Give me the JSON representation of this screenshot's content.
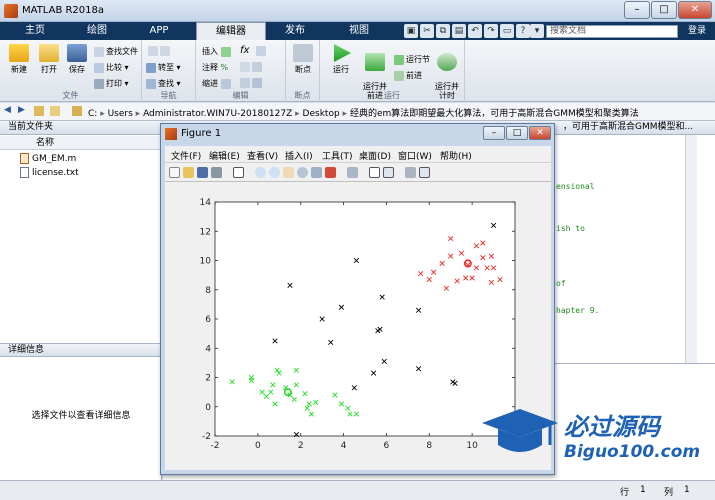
{
  "window": {
    "title": "MATLAB R2018a",
    "controls": {
      "minimize": "–",
      "maximize": "□",
      "close": "✕"
    }
  },
  "tabs": [
    {
      "label": "主页",
      "active": false
    },
    {
      "label": "绘图",
      "active": false
    },
    {
      "label": "APP",
      "active": false
    },
    {
      "label": "编辑器",
      "active": true
    },
    {
      "label": "发布",
      "active": false
    },
    {
      "label": "视图",
      "active": false
    }
  ],
  "search": {
    "placeholder": "搜索文档",
    "login": "登录"
  },
  "ribbon": {
    "file": {
      "label": "文件",
      "new": "新建",
      "open": "打开",
      "save": "保存",
      "find_files": "查找文件",
      "compare": "比较",
      "print": "打印"
    },
    "navigate": {
      "label": "导航",
      "goto": "转至",
      "find": "查找"
    },
    "edit": {
      "label": "编辑",
      "insert": "插入",
      "comment": "注释",
      "indent": "缩进",
      "fx": "fx"
    },
    "breakpoints": {
      "label": "断点",
      "breakpoints": "断点"
    },
    "run": {
      "label": "运行",
      "run": "运行",
      "run_advance": "运行并\n前进",
      "run_section": "运行节",
      "advance": "前进",
      "run_time": "运行并\n计时"
    }
  },
  "address": {
    "segments": [
      "C:",
      "Users",
      "Administrator.WIN7U-20180127Z",
      "Desktop",
      "经典的em算法即期望最大化算法，可用于高斯混合GMM模型和聚类算法"
    ]
  },
  "current_folder": {
    "title": "当前文件夹",
    "column": "名称",
    "files": [
      {
        "name": "GM_EM.m",
        "icon": "matlab-file-icon"
      },
      {
        "name": "license.txt",
        "icon": "text-file-icon"
      }
    ]
  },
  "details": {
    "title": "详细信息",
    "message": "选择文件以查看详细信息"
  },
  "editor": {
    "title_tail": "，可用于高斯混合GMM模型和...",
    "code_fragments": [
      "ensional",
      "ish to",
      "of",
      "hapter 9."
    ]
  },
  "status": {
    "row_label": "行",
    "row": "1",
    "col_label": "列",
    "col": "1"
  },
  "figure": {
    "title": "Figure 1",
    "menu": [
      "文件(F)",
      "编辑(E)",
      "查看(V)",
      "插入(I)",
      "工具(T)",
      "桌面(D)",
      "窗口(W)",
      "帮助(H)"
    ],
    "toolbar_icons": [
      "new-figure-icon",
      "open-icon",
      "save-icon",
      "print-icon",
      "pointer-icon",
      "zoom-in-icon",
      "zoom-out-icon",
      "pan-icon",
      "rotate-icon",
      "data-cursor-icon",
      "brush-icon",
      "link-icon",
      "colorbar-icon",
      "legend-icon",
      "hide-plot-tools-icon",
      "show-plot-tools-icon"
    ]
  },
  "chart_data": {
    "type": "scatter",
    "xlim": [
      -2,
      12
    ],
    "ylim": [
      -2,
      14
    ],
    "xticks": [
      -2,
      0,
      2,
      4,
      6,
      8,
      10,
      12
    ],
    "yticks": [
      -2,
      0,
      2,
      4,
      6,
      8,
      10,
      12,
      14
    ],
    "grid": false,
    "series": [
      {
        "color": "#000000",
        "marker": "x",
        "points": [
          [
            1.5,
            8.3
          ],
          [
            0.8,
            4.5
          ],
          [
            3.4,
            4.4
          ],
          [
            3.9,
            6.8
          ],
          [
            3.0,
            6.0
          ],
          [
            4.6,
            10.0
          ],
          [
            5.7,
            5.3
          ],
          [
            5.8,
            7.5
          ],
          [
            5.6,
            5.2
          ],
          [
            5.9,
            3.1
          ],
          [
            5.4,
            2.3
          ],
          [
            4.5,
            1.3
          ],
          [
            7.5,
            6.6
          ],
          [
            7.5,
            2.6
          ],
          [
            9.1,
            1.7
          ],
          [
            9.2,
            1.6
          ],
          [
            11.0,
            12.4
          ],
          [
            1.8,
            -1.9
          ]
        ]
      },
      {
        "color": "#ee2a24",
        "marker": "x",
        "points": [
          [
            9.0,
            11.5
          ],
          [
            9.5,
            10.5
          ],
          [
            9.0,
            10.3
          ],
          [
            8.6,
            9.8
          ],
          [
            8.2,
            9.2
          ],
          [
            7.6,
            9.1
          ],
          [
            8.8,
            8.1
          ],
          [
            9.7,
            8.8
          ],
          [
            10.0,
            8.8
          ],
          [
            10.2,
            9.5
          ],
          [
            10.5,
            11.2
          ],
          [
            10.5,
            10.2
          ],
          [
            10.9,
            10.3
          ],
          [
            11.3,
            8.7
          ],
          [
            10.9,
            8.5
          ],
          [
            11.0,
            9.5
          ],
          [
            10.2,
            11.0
          ],
          [
            10.7,
            9.5
          ],
          [
            9.3,
            8.6
          ],
          [
            8.0,
            8.7
          ],
          [
            9.8,
            9.7
          ]
        ]
      },
      {
        "color": "#22dd22",
        "marker": "x",
        "points": [
          [
            -1.2,
            1.7
          ],
          [
            -0.3,
            2.0
          ],
          [
            -0.3,
            1.8
          ],
          [
            0.2,
            1.0
          ],
          [
            0.4,
            0.7
          ],
          [
            0.6,
            1.0
          ],
          [
            0.7,
            1.5
          ],
          [
            0.9,
            2.5
          ],
          [
            1.0,
            2.3
          ],
          [
            0.8,
            0.2
          ],
          [
            1.3,
            1.3
          ],
          [
            1.5,
            0.8
          ],
          [
            1.8,
            1.5
          ],
          [
            1.8,
            2.5
          ],
          [
            1.7,
            0.5
          ],
          [
            2.2,
            0.9
          ],
          [
            2.3,
            -0.1
          ],
          [
            2.4,
            0.2
          ],
          [
            2.5,
            -0.5
          ],
          [
            2.7,
            0.3
          ],
          [
            3.6,
            0.8
          ],
          [
            3.9,
            0.2
          ],
          [
            4.2,
            -0.1
          ],
          [
            4.3,
            -0.5
          ],
          [
            4.6,
            -0.5
          ]
        ]
      }
    ],
    "centers": [
      {
        "x": 9.8,
        "y": 9.8,
        "color": "#ee2a24"
      },
      {
        "x": 1.4,
        "y": 1.0,
        "color": "#22dd22"
      }
    ]
  }
}
